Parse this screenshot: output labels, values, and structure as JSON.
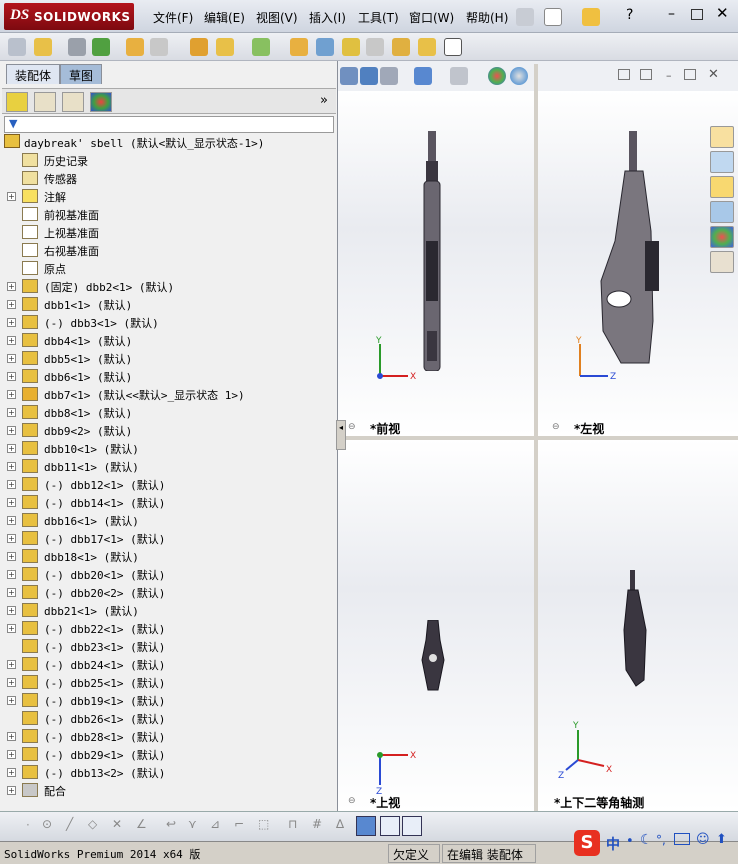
{
  "app": {
    "brand": "SOLIDWORKS",
    "brand_prefix": "DS"
  },
  "menu": [
    "文件(F)",
    "编辑(E)",
    "视图(V)",
    "插入(I)",
    "工具(T)",
    "窗口(W)",
    "帮助(H)"
  ],
  "tabs": {
    "assembly": "装配体",
    "sketch": "草图"
  },
  "tree": {
    "root": "daybreak' sbell  (默认<默认_显示状态-1>)",
    "items": [
      {
        "label": "历史记录",
        "icon": "history-icon",
        "expand": false
      },
      {
        "label": "传感器",
        "icon": "sensor-icon",
        "expand": false
      },
      {
        "label": "注解",
        "icon": "annotation-icon",
        "expand": true
      },
      {
        "label": "前视基准面",
        "icon": "plane-icon",
        "expand": false
      },
      {
        "label": "上视基准面",
        "icon": "plane-icon",
        "expand": false
      },
      {
        "label": "右视基准面",
        "icon": "plane-icon",
        "expand": false
      },
      {
        "label": "原点",
        "icon": "origin-icon",
        "expand": false
      },
      {
        "label": "(固定) dbb2<1> (默认)",
        "icon": "part-icon",
        "expand": true
      },
      {
        "label": "dbb1<1> (默认)",
        "icon": "part-icon",
        "expand": true
      },
      {
        "label": "(-) dbb3<1> (默认)",
        "icon": "part-icon",
        "expand": true
      },
      {
        "label": "dbb4<1> (默认)",
        "icon": "part-icon",
        "expand": true
      },
      {
        "label": "dbb5<1> (默认)",
        "icon": "part-icon",
        "expand": true
      },
      {
        "label": "dbb6<1> (默认)",
        "icon": "part-icon",
        "expand": true
      },
      {
        "label": "dbb7<1> (默认<<默认>_显示状态 1>)",
        "icon": "subassembly-icon",
        "expand": true
      },
      {
        "label": "dbb8<1> (默认)",
        "icon": "part-icon",
        "expand": true
      },
      {
        "label": "dbb9<2> (默认)",
        "icon": "part-icon",
        "expand": true
      },
      {
        "label": "dbb10<1> (默认)",
        "icon": "part-icon",
        "expand": true
      },
      {
        "label": "dbb11<1> (默认)",
        "icon": "part-icon",
        "expand": true
      },
      {
        "label": "(-) dbb12<1> (默认)",
        "icon": "part-icon",
        "expand": true
      },
      {
        "label": "(-) dbb14<1> (默认)",
        "icon": "part-icon",
        "expand": true
      },
      {
        "label": "dbb16<1> (默认)",
        "icon": "part-icon",
        "expand": true
      },
      {
        "label": "(-) dbb17<1> (默认)",
        "icon": "part-icon",
        "expand": true
      },
      {
        "label": "dbb18<1> (默认)",
        "icon": "part-icon",
        "expand": true
      },
      {
        "label": "(-) dbb20<1> (默认)",
        "icon": "part-icon",
        "expand": true
      },
      {
        "label": "(-) dbb20<2> (默认)",
        "icon": "part-icon",
        "expand": true
      },
      {
        "label": "dbb21<1> (默认)",
        "icon": "part-icon",
        "expand": true
      },
      {
        "label": "(-) dbb22<1> (默认)",
        "icon": "part-icon",
        "expand": true
      },
      {
        "label": "(-) dbb23<1> (默认)",
        "icon": "part-icon",
        "expand": false
      },
      {
        "label": "(-) dbb24<1> (默认)",
        "icon": "part-icon",
        "expand": true
      },
      {
        "label": "(-) dbb25<1> (默认)",
        "icon": "part-icon",
        "expand": true
      },
      {
        "label": "(-) dbb19<1> (默认)",
        "icon": "part-icon",
        "expand": true
      },
      {
        "label": "(-) dbb26<1> (默认)",
        "icon": "part-icon",
        "expand": false
      },
      {
        "label": "(-) dbb28<1> (默认)",
        "icon": "part-icon",
        "expand": true
      },
      {
        "label": "(-) dbb29<1> (默认)",
        "icon": "part-icon",
        "expand": true
      },
      {
        "label": "(-) dbb13<2> (默认)",
        "icon": "part-icon",
        "expand": true
      },
      {
        "label": "配合",
        "icon": "mates-icon",
        "expand": true
      }
    ]
  },
  "views": {
    "front": "*前视",
    "left": "*左视",
    "top": "*上视",
    "iso": "*上下二等角轴测"
  },
  "axes": {
    "x": "X",
    "y": "Y",
    "z": "Z"
  },
  "status": {
    "product": "SolidWorks Premium 2014 x64 版",
    "defined": "欠定义",
    "mode": "在编辑 装配体"
  },
  "ime": {
    "label": "中"
  },
  "colors": {
    "accent": "#b3141c",
    "triad_x": "#d42020",
    "triad_y": "#2a9a2a",
    "triad_z": "#2a4ad4"
  }
}
